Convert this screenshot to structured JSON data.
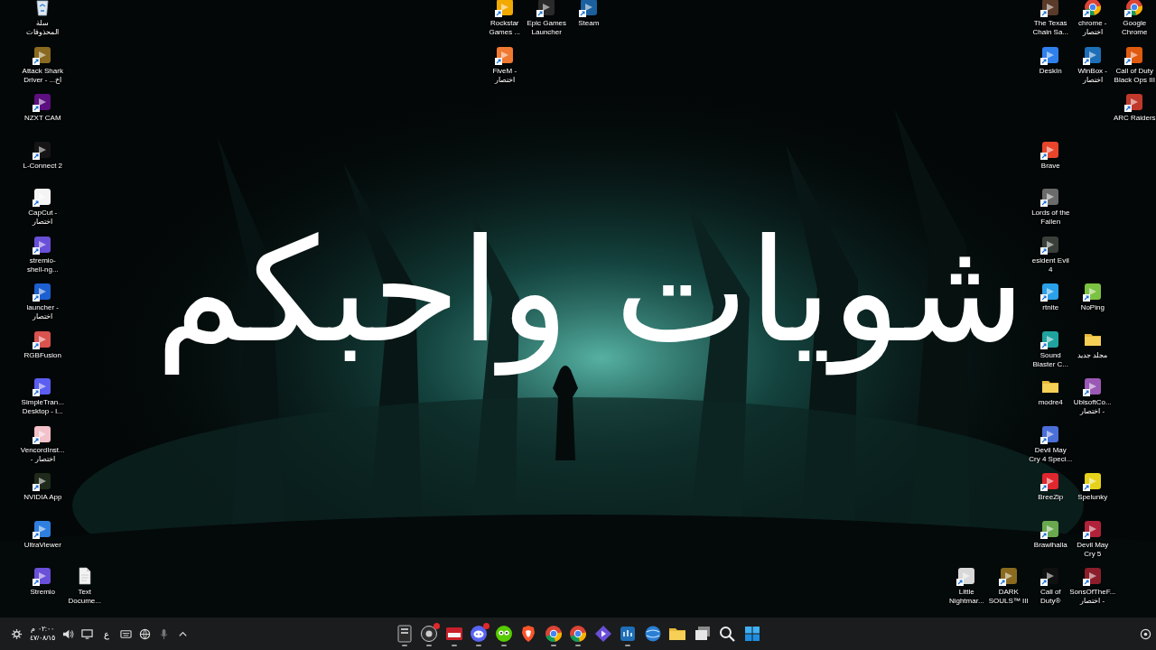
{
  "desktop": {
    "left_icons": [
      {
        "label": "سلة\nالمحذوفات",
        "kind": "recycle-bin",
        "shortcut": false
      },
      {
        "label": "Attack Shark\nDriver - ...اخ",
        "kind": "app",
        "shortcut": true,
        "color": "#8a6a20"
      },
      {
        "label": "NZXT CAM",
        "kind": "app",
        "shortcut": true,
        "color": "#5c1080"
      },
      {
        "label": "L-Connect 2",
        "kind": "app",
        "shortcut": true,
        "color": "#151515"
      },
      {
        "label": "CapCut -\nاختصار",
        "kind": "app",
        "shortcut": true,
        "color": "#f4f4f4"
      },
      {
        "label": "stremio-\nshell-ng...",
        "kind": "app",
        "shortcut": true,
        "color": "#6a4fd8"
      },
      {
        "label": "launcher -\nاختصار",
        "kind": "app",
        "shortcut": true,
        "color": "#1d5fd0"
      },
      {
        "label": "RGBFusion",
        "kind": "app",
        "shortcut": true,
        "color": "#d9534f"
      },
      {
        "label": "SimpleTran...\nDesktop - l...",
        "kind": "app",
        "shortcut": true,
        "color": "#5b5ef0"
      },
      {
        "label": "VencordInst...\n- اختصار",
        "kind": "app",
        "shortcut": true,
        "color": "#f2c1c9"
      },
      {
        "label": "NVIDIA App",
        "kind": "app",
        "shortcut": true,
        "color": "#1f2a1a"
      },
      {
        "label": "UltraViewer",
        "kind": "app",
        "shortcut": true,
        "color": "#2f7fe0"
      },
      {
        "label": "Text\nDocume...",
        "kind": "document",
        "shortcut": false
      },
      {
        "label": "Stremio",
        "kind": "app",
        "shortcut": true,
        "color": "#6a4fd8"
      }
    ],
    "top_icons": [
      {
        "label": "Steam",
        "kind": "app",
        "shortcut": true,
        "color": "#1b5f9e"
      },
      {
        "label": "Epic Games\nLauncher",
        "kind": "app",
        "shortcut": true,
        "color": "#2a2a2a"
      },
      {
        "label": "Rockstar\nGames ...",
        "kind": "app",
        "shortcut": true,
        "color": "#f2a900"
      },
      {
        "label": "FiveM -\nاختصار",
        "kind": "app",
        "shortcut": true,
        "color": "#f07a32"
      }
    ],
    "right_icons": [
      {
        "label": "Google\nChrome",
        "kind": "browser",
        "shortcut": true
      },
      {
        "label": "chrome -\nاختصار",
        "kind": "browser",
        "shortcut": true
      },
      {
        "label": "The Texas\nChain Sa...",
        "kind": "app",
        "shortcut": true,
        "color": "#5a3b2a"
      },
      {
        "label": "Call of Duty\nBlack Ops III",
        "kind": "app",
        "shortcut": true,
        "color": "#e05a10"
      },
      {
        "label": "WinBox -\nاختصار",
        "kind": "app",
        "shortcut": true,
        "color": "#1e6fb8"
      },
      {
        "label": "DeskIn",
        "kind": "app",
        "shortcut": true,
        "color": "#2f80ed"
      },
      {
        "label": "ARC Raiders",
        "kind": "app",
        "shortcut": true,
        "color": "#c0392b"
      },
      {
        "label": "Brave",
        "kind": "app",
        "shortcut": true,
        "color": "#e8452c"
      },
      {
        "label": "Lords of the\nFallen",
        "kind": "app",
        "shortcut": true,
        "color": "#6b6b6b"
      },
      {
        "label": "esident Evil\n4",
        "kind": "app",
        "shortcut": true,
        "color": "#3a3f3a"
      },
      {
        "label": "NoPing",
        "kind": "app",
        "shortcut": true,
        "color": "#7cc242"
      },
      {
        "label": "rtnite",
        "kind": "app",
        "shortcut": true,
        "color": "#2aa0e8"
      },
      {
        "label": "مجلد جديد",
        "kind": "folder",
        "shortcut": false
      },
      {
        "label": "Sound\nBlaster C...",
        "kind": "app",
        "shortcut": true,
        "color": "#20a39e"
      },
      {
        "label": "UbisoftCo...\nاختصار -",
        "kind": "app",
        "shortcut": true,
        "color": "#9b59b6"
      },
      {
        "label": "modre4",
        "kind": "folder",
        "shortcut": false
      },
      {
        "label": "Devil May\nCry 4 Speci...",
        "kind": "app",
        "shortcut": true,
        "color": "#4a6fd8"
      },
      {
        "label": "Spelunky",
        "kind": "app",
        "shortcut": true,
        "color": "#e6d21a"
      },
      {
        "label": "BreeZip",
        "kind": "app",
        "shortcut": true,
        "color": "#e0262e"
      },
      {
        "label": "Devil May\nCry 5",
        "kind": "app",
        "shortcut": true,
        "color": "#b0213a"
      },
      {
        "label": "Brawlhalla",
        "kind": "app",
        "shortcut": true,
        "color": "#6aa84f"
      },
      {
        "label": "SonsOfTheF...\nاختصار -",
        "kind": "app",
        "shortcut": true,
        "color": "#8b1e2a"
      },
      {
        "label": "Call of\nDuty®",
        "kind": "app",
        "shortcut": true,
        "color": "#101010"
      },
      {
        "label": "DARK\nSOULS™ III",
        "kind": "app",
        "shortcut": true,
        "color": "#8a6a1e"
      },
      {
        "label": "Little\nNightmar...",
        "kind": "app",
        "shortcut": true,
        "color": "#d8d8d8"
      }
    ]
  },
  "overlay_text": "شويات واحبكم",
  "taskbar": {
    "time": "٠٢:٠٠ م",
    "date": "٤٧/٠٨/١٥",
    "language": "ع",
    "apps": [
      {
        "running": true,
        "badge": false
      },
      {
        "running": true,
        "badge": true
      },
      {
        "running": true,
        "badge": false
      },
      {
        "running": true,
        "badge": true
      },
      {
        "running": true,
        "badge": false
      },
      {
        "running": false,
        "badge": false
      },
      {
        "running": true,
        "badge": false
      },
      {
        "running": true,
        "badge": false
      },
      {
        "running": false,
        "badge": false
      },
      {
        "running": true,
        "badge": false
      },
      {
        "running": false,
        "badge": false
      },
      {
        "running": false,
        "badge": false
      },
      {
        "running": false,
        "badge": false
      },
      {
        "running": false,
        "badge": false
      },
      {
        "running": false,
        "badge": false
      }
    ]
  }
}
